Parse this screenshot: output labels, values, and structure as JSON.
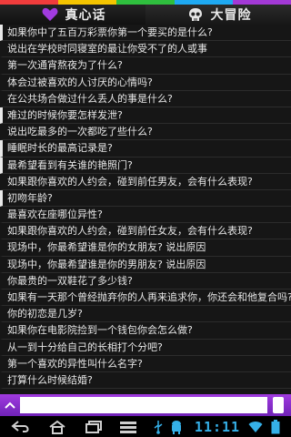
{
  "colors": {
    "strip": [
      "#f03c3c",
      "#f4c400",
      "#2fbf3e",
      "#1ea9f2",
      "#a339d6"
    ],
    "accent": "#a13be0",
    "clock": "#35b0e8"
  },
  "tabs": [
    {
      "label": "真心话",
      "icon": "heart-icon",
      "active": true
    },
    {
      "label": "大冒险",
      "icon": "skull-icon",
      "active": false
    }
  ],
  "questions": [
    "如果你中了五百万彩票你第一个要买的是什么?",
    "说出在学校时同寝室的最让你受不了的人或事",
    "第一次通宵熬夜为了什么?",
    "体会过被喜欢的人讨厌的心情吗?",
    "在公共场合做过什么丢人的事是什么?",
    "难过的时候你要怎样发泄?",
    "说出吃最多的一次都吃了些什么?",
    "睡眠时长的最高记录是?",
    "最希望看到有关谁的艳照门?",
    "如果跟你喜欢的人约会，碰到前任男友，会有什么表现?",
    "初吻年龄?",
    "最喜欢在座哪位异性?",
    "如果跟你喜欢的人约会，碰到前任女友，会有什么表现?",
    "现场中，你最希望谁是你的女朋友? 说出原因",
    "现场中，你最希望谁是你的男朋友? 说出原因",
    "你最贵的一双鞋花了多少钱?",
    "如果有一天那个曾经抛弃你的人再来追求你，你还会和他复合吗?",
    "你的初恋是几岁?",
    "如果你在电影院捡到一个钱包你会怎么做?",
    "从一到十分给自己的长相打个分吧?",
    "第一个喜欢的异性叫什么名字?",
    "打算什么时候结婚?"
  ],
  "input": {
    "value": "",
    "placeholder": ""
  },
  "status": {
    "clock": "11:11"
  }
}
